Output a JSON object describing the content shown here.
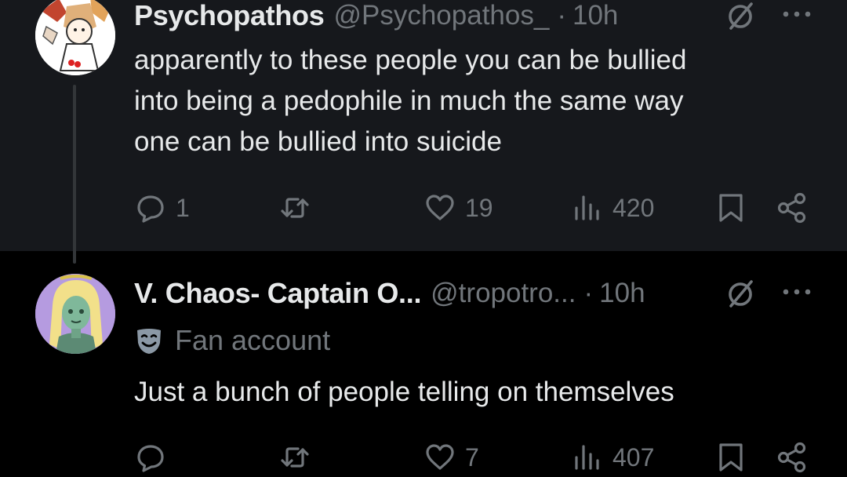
{
  "posts": [
    {
      "name": "Psychopathos",
      "handle": "@Psychopathos_",
      "separator": "·",
      "time": "10h",
      "text": "apparently to these people you can be bullied\ninto being a pedophile in much the same way\none can be bullied into suicide",
      "actions": {
        "replies": "1",
        "reposts": "",
        "likes": "19",
        "views": "420"
      }
    },
    {
      "name": "V. Chaos- Captain O...",
      "handle": "@tropotro...",
      "separator": "·",
      "time": "10h",
      "label": "Fan account",
      "text": "Just a bunch of people telling on themselves",
      "actions": {
        "replies": "",
        "reposts": "",
        "likes": "7",
        "views": "407"
      }
    }
  ],
  "icons": {
    "grok": "grok-slash-icon",
    "more": "more-dots-icon",
    "reply": "reply-bubble-icon",
    "repost": "repost-arrows-icon",
    "like": "heart-icon",
    "views": "views-bars-icon",
    "bookmark": "bookmark-icon",
    "share": "share-icon",
    "fan": "theater-mask-icon"
  },
  "colors": {
    "background": "#000000",
    "highlighted_post": "#16181c",
    "text": "#e7e9ea",
    "muted": "#71767b",
    "thread_line": "#333639"
  }
}
